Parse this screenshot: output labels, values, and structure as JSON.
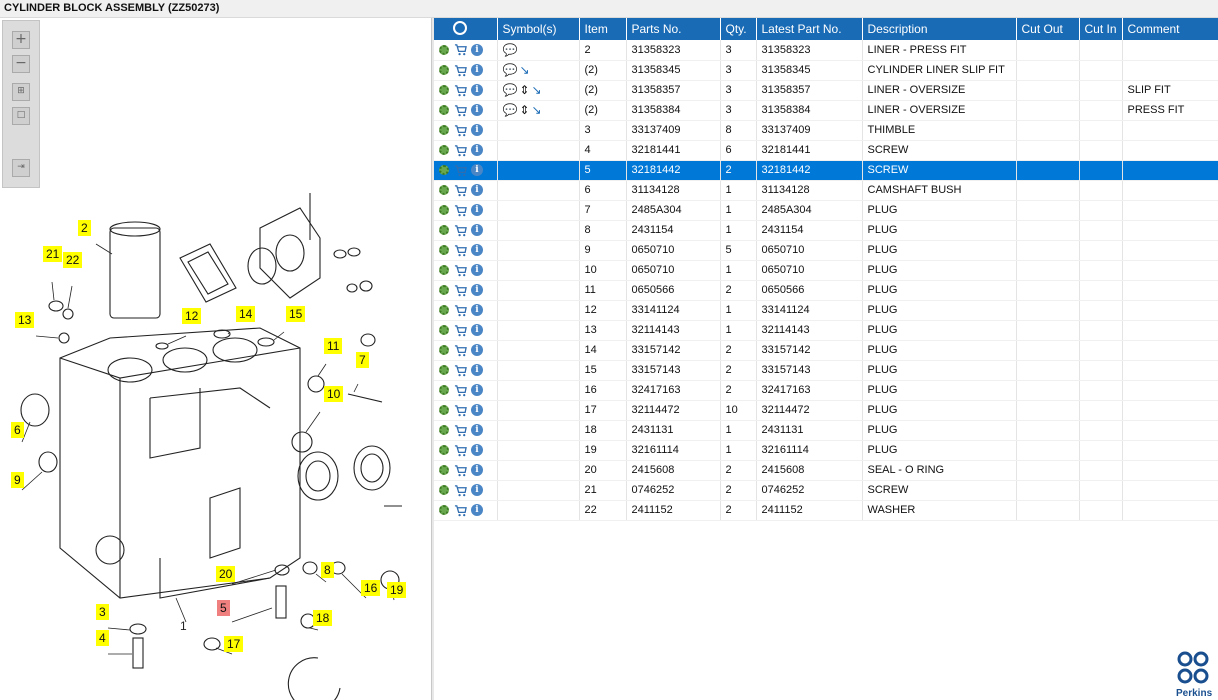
{
  "window": {
    "title": "CYLINDER BLOCK ASSEMBLY (ZZ50273)"
  },
  "toolbar": {
    "buttons": [
      "zoom-in",
      "zoom-out",
      "fit-page",
      "actual-size",
      "export"
    ]
  },
  "diagram": {
    "callouts": [
      "2",
      "21",
      "22",
      "13",
      "12",
      "14",
      "15",
      "11",
      "7",
      "10",
      "6",
      "9",
      "20",
      "8",
      "16",
      "19",
      "5",
      "18",
      "17",
      "3",
      "4",
      "1"
    ],
    "highlighted_callout": "5"
  },
  "grid": {
    "columns": [
      "",
      "Symbol(s)",
      "Item",
      "Parts No.",
      "Qty.",
      "Latest Part No.",
      "Description",
      "Cut Out",
      "Cut In",
      "Comment"
    ],
    "rows": [
      {
        "item": "2",
        "parts_no": "31358323",
        "qty": "3",
        "latest": "31358323",
        "desc": "LINER - PRESS FIT",
        "comment": "",
        "symbols": "note"
      },
      {
        "item": "(2)",
        "parts_no": "31358345",
        "qty": "3",
        "latest": "31358345",
        "desc": "CYLINDER LINER SLIP FIT",
        "comment": "",
        "symbols": "note-arrow"
      },
      {
        "item": "(2)",
        "parts_no": "31358357",
        "qty": "3",
        "latest": "31358357",
        "desc": "LINER - OVERSIZE",
        "comment": "SLIP FIT",
        "symbols": "note-split-arrow"
      },
      {
        "item": "(2)",
        "parts_no": "31358384",
        "qty": "3",
        "latest": "31358384",
        "desc": "LINER - OVERSIZE",
        "comment": "PRESS FIT",
        "symbols": "note-split-arrow"
      },
      {
        "item": "3",
        "parts_no": "33137409",
        "qty": "8",
        "latest": "33137409",
        "desc": "THIMBLE",
        "comment": "",
        "symbols": ""
      },
      {
        "item": "4",
        "parts_no": "32181441",
        "qty": "6",
        "latest": "32181441",
        "desc": "SCREW",
        "comment": "",
        "symbols": ""
      },
      {
        "item": "5",
        "parts_no": "32181442",
        "qty": "2",
        "latest": "32181442",
        "desc": "SCREW",
        "comment": "",
        "symbols": "",
        "selected": true
      },
      {
        "item": "6",
        "parts_no": "31134128",
        "qty": "1",
        "latest": "31134128",
        "desc": "CAMSHAFT BUSH",
        "comment": "",
        "symbols": ""
      },
      {
        "item": "7",
        "parts_no": "2485A304",
        "qty": "1",
        "latest": "2485A304",
        "desc": "PLUG",
        "comment": "",
        "symbols": ""
      },
      {
        "item": "8",
        "parts_no": "2431154",
        "qty": "1",
        "latest": "2431154",
        "desc": "PLUG",
        "comment": "",
        "symbols": ""
      },
      {
        "item": "9",
        "parts_no": "0650710",
        "qty": "5",
        "latest": "0650710",
        "desc": "PLUG",
        "comment": "",
        "symbols": ""
      },
      {
        "item": "10",
        "parts_no": "0650710",
        "qty": "1",
        "latest": "0650710",
        "desc": "PLUG",
        "comment": "",
        "symbols": ""
      },
      {
        "item": "11",
        "parts_no": "0650566",
        "qty": "2",
        "latest": "0650566",
        "desc": "PLUG",
        "comment": "",
        "symbols": ""
      },
      {
        "item": "12",
        "parts_no": "33141124",
        "qty": "1",
        "latest": "33141124",
        "desc": "PLUG",
        "comment": "",
        "symbols": ""
      },
      {
        "item": "13",
        "parts_no": "32114143",
        "qty": "1",
        "latest": "32114143",
        "desc": "PLUG",
        "comment": "",
        "symbols": ""
      },
      {
        "item": "14",
        "parts_no": "33157142",
        "qty": "2",
        "latest": "33157142",
        "desc": "PLUG",
        "comment": "",
        "symbols": ""
      },
      {
        "item": "15",
        "parts_no": "33157143",
        "qty": "2",
        "latest": "33157143",
        "desc": "PLUG",
        "comment": "",
        "symbols": ""
      },
      {
        "item": "16",
        "parts_no": "32417163",
        "qty": "2",
        "latest": "32417163",
        "desc": "PLUG",
        "comment": "",
        "symbols": ""
      },
      {
        "item": "17",
        "parts_no": "32114472",
        "qty": "10",
        "latest": "32114472",
        "desc": "PLUG",
        "comment": "",
        "symbols": ""
      },
      {
        "item": "18",
        "parts_no": "2431131",
        "qty": "1",
        "latest": "2431131",
        "desc": "PLUG",
        "comment": "",
        "symbols": ""
      },
      {
        "item": "19",
        "parts_no": "32161114",
        "qty": "1",
        "latest": "32161114",
        "desc": "PLUG",
        "comment": "",
        "symbols": ""
      },
      {
        "item": "20",
        "parts_no": "2415608",
        "qty": "2",
        "latest": "2415608",
        "desc": "SEAL - O RING",
        "comment": "",
        "symbols": ""
      },
      {
        "item": "21",
        "parts_no": "0746252",
        "qty": "2",
        "latest": "0746252",
        "desc": "SCREW",
        "comment": "",
        "symbols": ""
      },
      {
        "item": "22",
        "parts_no": "2411152",
        "qty": "2",
        "latest": "2411152",
        "desc": "WASHER",
        "comment": "",
        "symbols": ""
      }
    ]
  },
  "brand": {
    "name": "Perkins"
  },
  "colors": {
    "header_bg": "#1a6bb5",
    "selection": "#0078d7",
    "callout": "#ffff00",
    "callout_highlight": "#f08080"
  }
}
